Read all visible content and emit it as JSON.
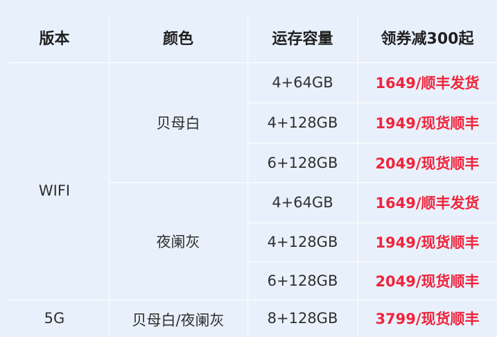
{
  "header": {
    "version": "版本",
    "color": "颜色",
    "memory": "运存容量",
    "coupon": "领券减300起"
  },
  "groups": [
    {
      "version": "WIFI",
      "colors": [
        {
          "name": "贝母白",
          "rows": [
            {
              "memory": "4+64GB",
              "price": "1649/顺丰发货"
            },
            {
              "memory": "4+128GB",
              "price": "1949/现货顺丰"
            },
            {
              "memory": "6+128GB",
              "price": "2049/现货顺丰"
            }
          ]
        },
        {
          "name": "夜阑灰",
          "rows": [
            {
              "memory": "4+64GB",
              "price": "1649/顺丰发货"
            },
            {
              "memory": "4+128GB",
              "price": "1949/现货顺丰"
            },
            {
              "memory": "6+128GB",
              "price": "2049/现货顺丰"
            }
          ]
        }
      ]
    },
    {
      "version": "5G",
      "colors": [
        {
          "name": "贝母白/夜阑灰",
          "rows": [
            {
              "memory": "8+128GB",
              "price": "3799/现货顺丰"
            }
          ]
        }
      ]
    }
  ],
  "colors": {
    "background": "#e8f1fb",
    "price": "#f0243c",
    "grid": "#ffffff"
  }
}
